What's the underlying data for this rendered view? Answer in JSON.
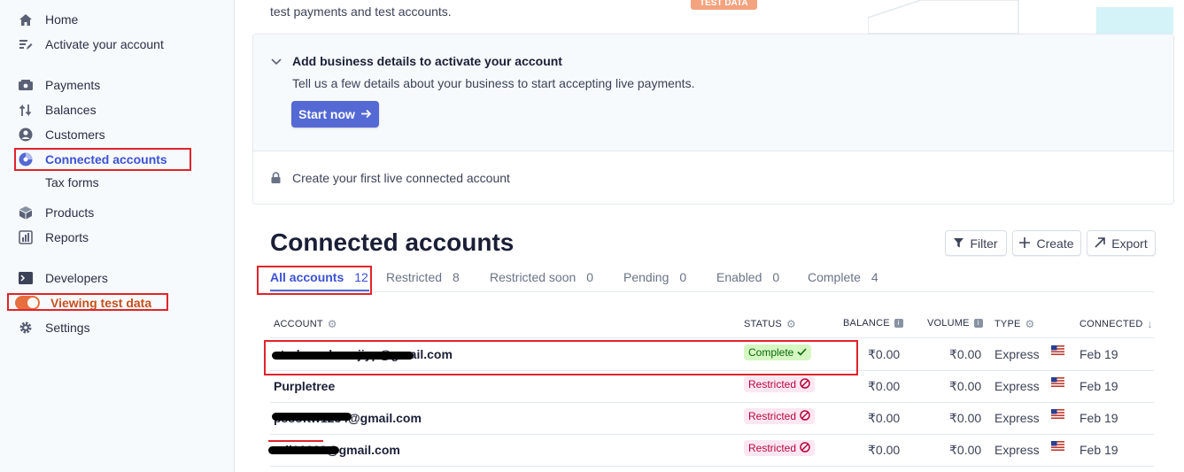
{
  "sidebar": {
    "home": "Home",
    "activate": "Activate your account",
    "payments": "Payments",
    "balances": "Balances",
    "customers": "Customers",
    "connected_accounts": "Connected accounts",
    "tax_forms": "Tax forms",
    "products": "Products",
    "reports": "Reports",
    "developers": "Developers",
    "viewing_test_data": "Viewing test data",
    "settings": "Settings"
  },
  "banner": {
    "text": "test payments and test accounts.",
    "badge": "TEST DATA"
  },
  "activation": {
    "title": "Add business details to activate your account",
    "description": "Tell us a few details about your business to start accepting live payments.",
    "start_button": "Start now",
    "live_account": "Create your first live connected account"
  },
  "page": {
    "title": "Connected accounts",
    "filter": "Filter",
    "create": "Create",
    "export": "Export"
  },
  "tabs": [
    {
      "label": "All accounts",
      "count": "12"
    },
    {
      "label": "Restricted",
      "count": "8"
    },
    {
      "label": "Restricted soon",
      "count": "0"
    },
    {
      "label": "Pending",
      "count": "0"
    },
    {
      "label": "Enabled",
      "count": "0"
    },
    {
      "label": "Complete",
      "count": "4"
    }
  ],
  "table": {
    "headers": {
      "account": "ACCOUNT",
      "status": "STATUS",
      "balance": "BALANCE",
      "volume": "VOLUME",
      "type": "TYPE",
      "connected": "CONNECTED"
    },
    "rows": [
      {
        "account": "atodsmedemojiyp@gmail.com",
        "status": "Complete",
        "balance": "₹0.00",
        "volume": "₹0.00",
        "type": "Express",
        "connected": "Feb 19"
      },
      {
        "account": "Purpletree",
        "status": "Restricted",
        "balance": "₹0.00",
        "volume": "₹0.00",
        "type": "Express",
        "connected": "Feb 19"
      },
      {
        "account": "pssoftw1234@gmail.com",
        "status": "Restricted",
        "balance": "₹0.00",
        "volume": "₹0.00",
        "type": "Express",
        "connected": "Feb 19"
      },
      {
        "account": "rali01329@gmail.com",
        "status": "Restricted",
        "balance": "₹0.00",
        "volume": "₹0.00",
        "type": "Express",
        "connected": "Feb 19"
      }
    ]
  },
  "colors": {
    "accent": "#5469d4",
    "highlight_box": "#e0242a",
    "test_toggle": "#e56f3f"
  }
}
